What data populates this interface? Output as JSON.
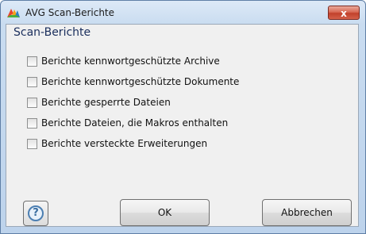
{
  "window": {
    "title": "AVG Scan-Berichte",
    "close_label": "x"
  },
  "heading": "Scan-Berichte",
  "options": [
    {
      "label": "Berichte kennwortgeschützte Archive",
      "checked": false
    },
    {
      "label": "Berichte kennwortgeschützte Dokumente",
      "checked": false
    },
    {
      "label": "Berichte gesperrte Dateien",
      "checked": false
    },
    {
      "label": "Berichte Dateien, die Makros enthalten",
      "checked": false
    },
    {
      "label": "Berichte versteckte Erweiterungen",
      "checked": false
    }
  ],
  "buttons": {
    "help_glyph": "?",
    "ok_label": "OK",
    "cancel_label": "Abbrechen"
  },
  "icons": {
    "app": "avg-logo-icon",
    "help": "help-icon"
  }
}
